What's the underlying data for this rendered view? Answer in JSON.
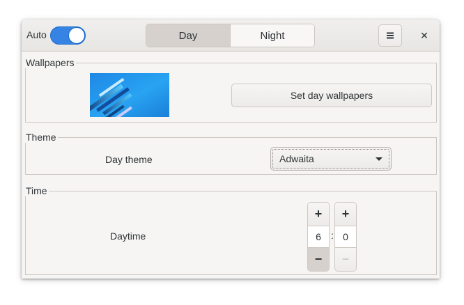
{
  "header": {
    "auto_label": "Auto",
    "auto_switch_on": true,
    "tabs": [
      {
        "label": "Day",
        "active": true
      },
      {
        "label": "Night",
        "active": false
      }
    ],
    "menu_icon": "hamburger-menu-icon",
    "close_glyph": "✕",
    "accent_color": "#3584e4"
  },
  "wallpapers": {
    "section_label": "Wallpapers",
    "set_button_label": "Set day wallpapers"
  },
  "theme": {
    "section_label": "Theme",
    "row_label": "Day theme",
    "selected": "Adwaita"
  },
  "time": {
    "section_label": "Time",
    "row_label": "Daytime",
    "hour": "6",
    "minute": "0",
    "separator": ":",
    "plus_glyph": "+",
    "minus_glyph": "−"
  }
}
